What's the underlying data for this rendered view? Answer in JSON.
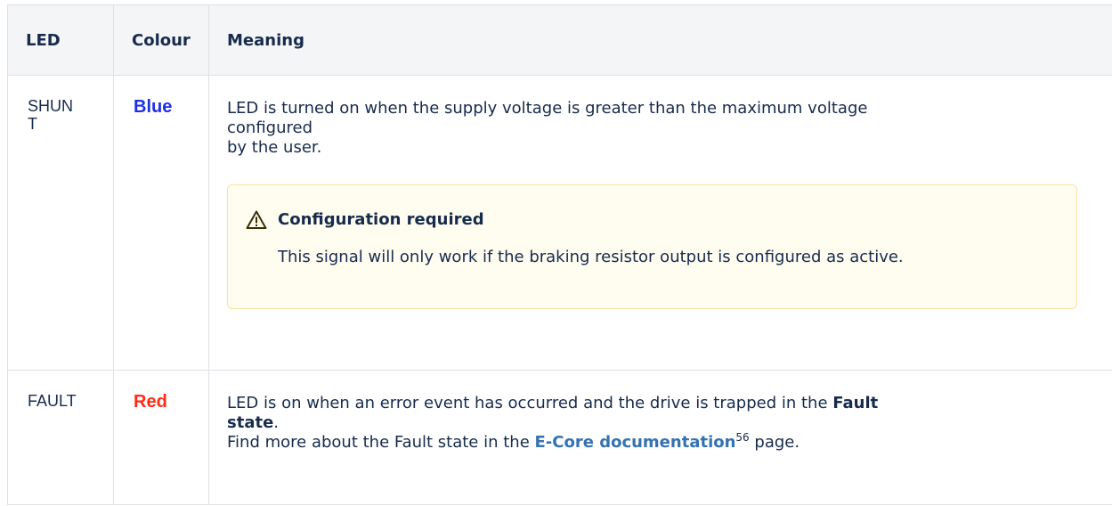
{
  "table": {
    "headers": {
      "led": "LED",
      "colour": "Colour",
      "meaning": "Meaning"
    },
    "rows": [
      {
        "led_part1": "SHUN",
        "led_part2": "T",
        "colour": "Blue",
        "colour_hex": "#1f30e8",
        "meaning_line1": "LED is turned on when the supply voltage is greater than the maximum voltage",
        "meaning_line2": "configured",
        "meaning_line3": "by the user.",
        "panel": {
          "icon": "warning-triangle-icon",
          "title": "Configuration required",
          "body": "This signal will only work if the braking resistor output is configured as active."
        }
      },
      {
        "led": "FAULT",
        "colour": "Red",
        "colour_hex": "#ff2b12",
        "meaning_line1_pre": "LED is on when an error event has occurred and the drive is trapped in the ",
        "meaning_line1_bold": "Fault",
        "meaning_line2_bold": "state",
        "meaning_line2_post": ".",
        "meaning_line3_pre": "Find more about the Fault state in the ",
        "meaning_line3_link": "E-Core documentation",
        "meaning_line3_sup": "56",
        "meaning_line3_post": " page."
      }
    ]
  }
}
